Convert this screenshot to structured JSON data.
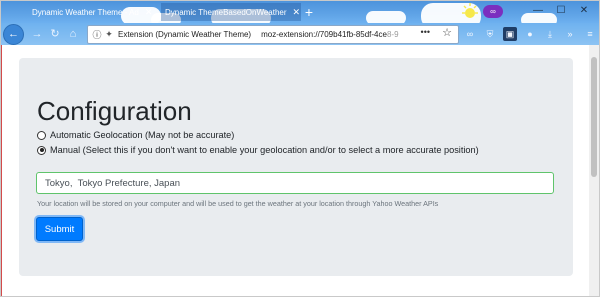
{
  "browser": {
    "tabs": [
      {
        "label": "Dynamic Weather Theme - Ad"
      },
      {
        "label": "Dynamic ThemeBasedOnWeather"
      }
    ],
    "new_tab_symbol": "+",
    "window_controls": {
      "minimize": "—",
      "maximize": "☐",
      "close": "✕"
    },
    "mask_badge": "∞",
    "nav": {
      "back_icon": "arrow-left-icon",
      "forward_icon": "arrow-right-icon",
      "reload_icon": "reload-icon",
      "home_icon": "home-icon"
    },
    "urlbar": {
      "identity_label": "Extension (Dynamic Weather Theme)",
      "address": "moz-extension://709b41fb-85df-4ce",
      "address_faded": "8-9",
      "more_symbol": "•••",
      "star_symbol": "☆"
    },
    "toolbar_icons": [
      "extension-icon",
      "shield-icon",
      "container-icon",
      "download-icon",
      "overflow-icon"
    ],
    "theme_colors": {
      "sky_top": "#4d93dc",
      "sky_bottom": "#8cc3f3",
      "cloud": "#ffffff"
    }
  },
  "page": {
    "title": "Configuration",
    "options": [
      {
        "label": "Automatic Geolocation (May not be accurate)",
        "checked": false
      },
      {
        "label": "Manual (Select this if you don't want to enable your geolocation and/or to select a more accurate position)",
        "checked": true
      }
    ],
    "location_input": {
      "value": "Tokyo,  Tokyo Prefecture, Japan"
    },
    "help_text": "Your location will be stored on your computer and will be used to get the weather at your location through Yahoo Weather APIs",
    "submit_label": "Submit",
    "colors": {
      "accent": "#007bff",
      "panel": "#e9ecef",
      "input_border": "#5fc46b"
    }
  }
}
